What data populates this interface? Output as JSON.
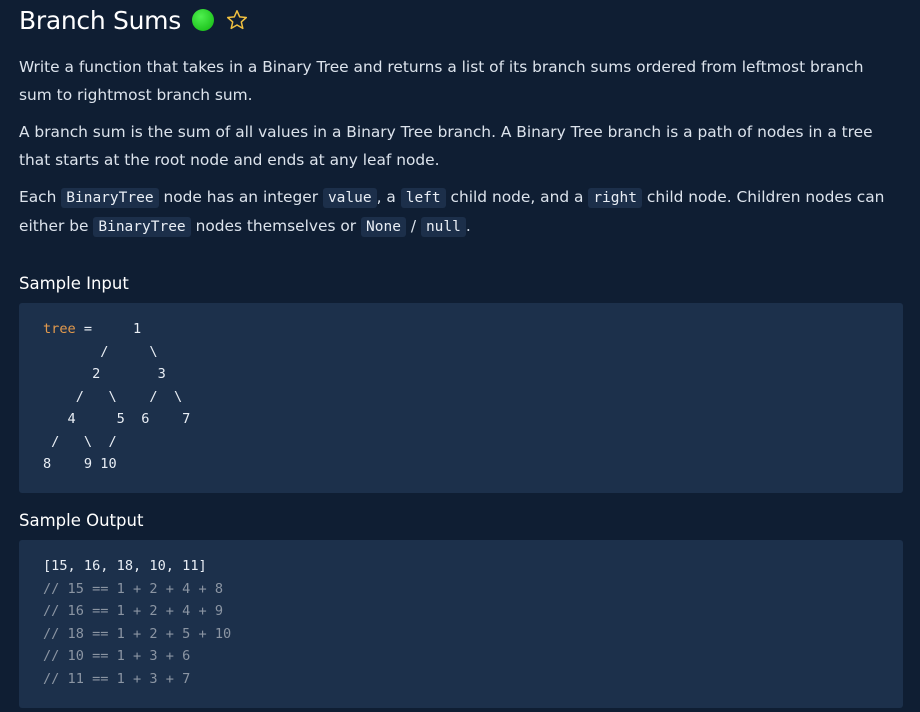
{
  "problem": {
    "title": "Branch Sums",
    "difficulty_color": "#22c722",
    "star_color": "#f0c040",
    "icons": {
      "difficulty": "difficulty-dot-icon",
      "favorite": "star-icon"
    }
  },
  "description": {
    "p1": "Write a function that takes in a Binary Tree and returns a list of its branch sums ordered from leftmost branch sum to rightmost branch sum.",
    "p2": "A branch sum is the sum of all values in a Binary Tree branch. A Binary Tree branch is a path of nodes in a tree that starts at the root node and ends at any leaf node.",
    "p3": {
      "t1": "Each ",
      "c1": "BinaryTree",
      "t2": " node has an integer ",
      "c2": "value",
      "t3": ", a ",
      "c3": "left",
      "t4": " child node, and a ",
      "c4": "right",
      "t5": " child node. Children nodes can either be ",
      "c5": "BinaryTree",
      "t6": " nodes themselves or ",
      "c6": "None",
      "t7": " / ",
      "c7": "null",
      "t8": "."
    }
  },
  "sample_input": {
    "heading": "Sample Input",
    "var_name": "tree",
    "code_after_var": " =     1\n       /     \\\n      2       3\n    /   \\    /  \\\n   4     5  6    7\n /   \\  /\n8    9 10"
  },
  "sample_output": {
    "heading": "Sample Output",
    "result": "[15, 16, 18, 10, 11]",
    "comments": [
      "// 15 == 1 + 2 + 4 + 8",
      "// 16 == 1 + 2 + 4 + 9",
      "// 18 == 1 + 2 + 5 + 10",
      "// 10 == 1 + 3 + 6",
      "// 11 == 1 + 3 + 7"
    ]
  }
}
